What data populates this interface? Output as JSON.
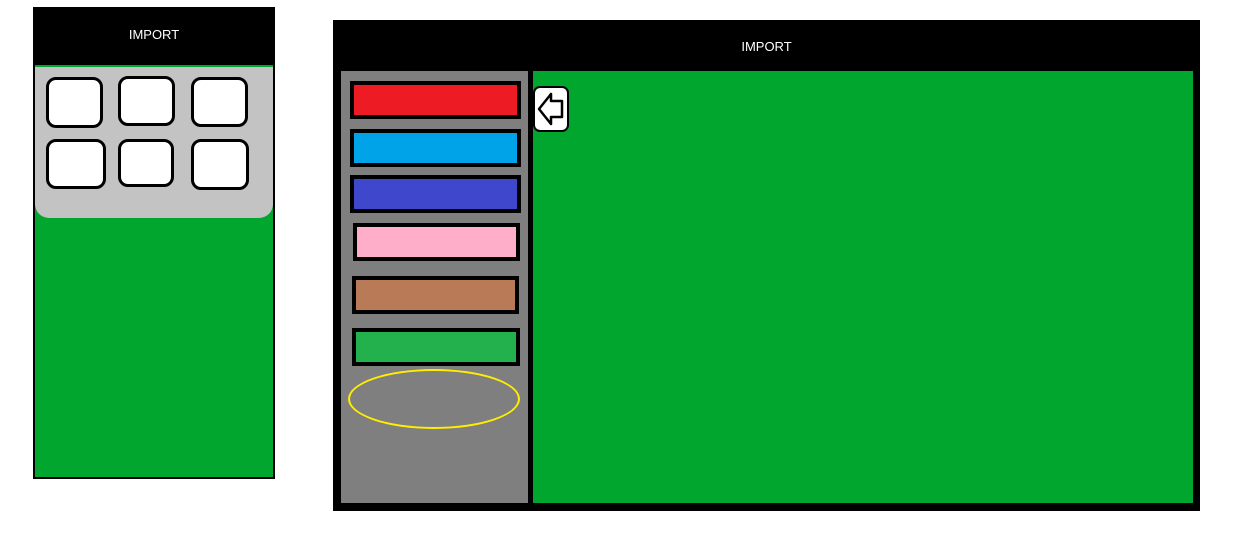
{
  "mobile": {
    "title": "IMPORT",
    "tiles": [
      "",
      "",
      "",
      "",
      "",
      ""
    ]
  },
  "desktop": {
    "title": "IMPORT",
    "swatches": [
      {
        "color": "#ed1c24"
      },
      {
        "color": "#00a2e8"
      },
      {
        "color": "#3f48cc"
      },
      {
        "color": "#ffaec9"
      },
      {
        "color": "#b97a57"
      },
      {
        "color": "#22b14c",
        "highlighted": true
      }
    ],
    "back_icon": "back-arrow-icon"
  },
  "colors": {
    "content_bg": "#00a62d",
    "sidebar_bg": "#7f7f7f",
    "panel_bg": "#c3c3c3",
    "header_bg": "#000000",
    "highlight_outline": "#ffee00"
  }
}
